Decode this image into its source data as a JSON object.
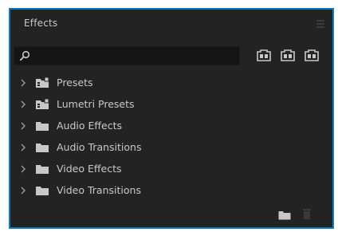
{
  "panel": {
    "title": "Effects"
  },
  "search": {
    "value": "",
    "placeholder": ""
  },
  "colors": {
    "panel_bg": "#232323",
    "focus_border": "#0f7bbf",
    "text": "#c9c9c9",
    "icon": "#c8c8c8",
    "icon_disabled": "#3a3a3a"
  },
  "filters": [
    {
      "icon": "accelerated-effects-icon"
    },
    {
      "icon": "32-bit-color-icon"
    },
    {
      "icon": "yuv-effects-icon"
    }
  ],
  "tree": {
    "items": [
      {
        "label": "Presets",
        "icon": "presets-folder-icon"
      },
      {
        "label": "Lumetri Presets",
        "icon": "presets-folder-icon"
      },
      {
        "label": "Audio Effects",
        "icon": "folder-icon"
      },
      {
        "label": "Audio Transitions",
        "icon": "folder-icon"
      },
      {
        "label": "Video Effects",
        "icon": "folder-icon"
      },
      {
        "label": "Video Transitions",
        "icon": "folder-icon"
      }
    ]
  },
  "footer": {
    "new_bin_icon": "new-bin-icon",
    "delete_icon": "trash-icon"
  }
}
